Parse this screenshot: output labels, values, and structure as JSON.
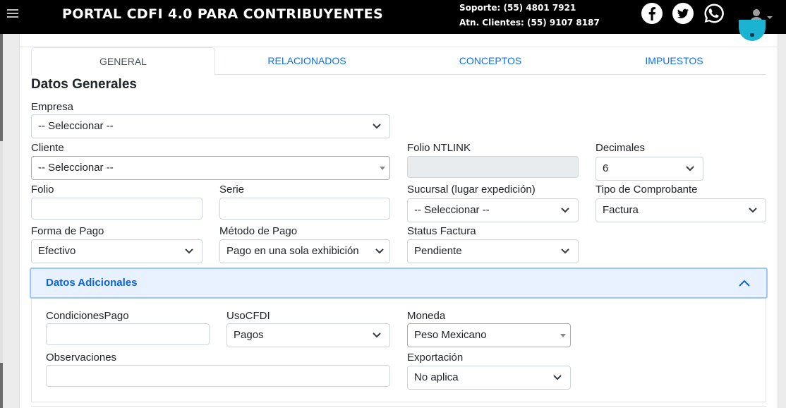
{
  "header": {
    "title": "PORTAL CDFI 4.0 PARA CONTRIBUYENTES",
    "support": "Soporte: (55) 4801 7921",
    "clients": "Atn. Clientes: (55) 9107 8187",
    "social_icons": [
      "facebook-icon",
      "twitter-icon",
      "whatsapp-icon"
    ],
    "user_icon": "user-icon"
  },
  "colors": {
    "topbar": "#000000",
    "tab_link": "#0d6efd",
    "accordion_bg": "#e7f1ff",
    "accordion_text": "#0c63e4",
    "fab": "#1ab3d1"
  },
  "tabs": [
    {
      "label": "GENERAL",
      "active": true
    },
    {
      "label": "RELACIONADOS",
      "active": false
    },
    {
      "label": "CONCEPTOS",
      "active": false
    },
    {
      "label": "IMPUESTOS",
      "active": false
    }
  ],
  "datos_generales": {
    "title": "Datos Generales",
    "empresa": {
      "label": "Empresa",
      "value": "-- Seleccionar --"
    },
    "cliente": {
      "label": "Cliente",
      "value": "-- Seleccionar --"
    },
    "folio_ntlink": {
      "label": "Folio NTLINK",
      "value": ""
    },
    "decimales": {
      "label": "Decimales",
      "value": "6"
    },
    "folio": {
      "label": "Folio",
      "value": ""
    },
    "serie": {
      "label": "Serie",
      "value": ""
    },
    "sucursal": {
      "label": "Sucursal (lugar expedición)",
      "value": "-- Seleccionar --"
    },
    "tipo_comprobante": {
      "label": "Tipo de Comprobante",
      "value": "Factura"
    },
    "forma_pago": {
      "label": "Forma de Pago",
      "value": "Efectivo"
    },
    "metodo_pago": {
      "label": "Método de Pago",
      "value": "Pago en una sola exhibición"
    },
    "status_factura": {
      "label": "Status Factura",
      "value": "Pendiente"
    }
  },
  "datos_adicionales": {
    "title": "Datos Adicionales",
    "expanded": true,
    "condiciones_pago": {
      "label": "CondicionesPago",
      "value": ""
    },
    "uso_cfdi": {
      "label": "UsoCFDI",
      "value": "Pagos"
    },
    "moneda": {
      "label": "Moneda",
      "value": "Peso Mexicano"
    },
    "observaciones": {
      "label": "Observaciones",
      "value": ""
    },
    "exportacion": {
      "label": "Exportación",
      "value": "No aplica"
    }
  }
}
